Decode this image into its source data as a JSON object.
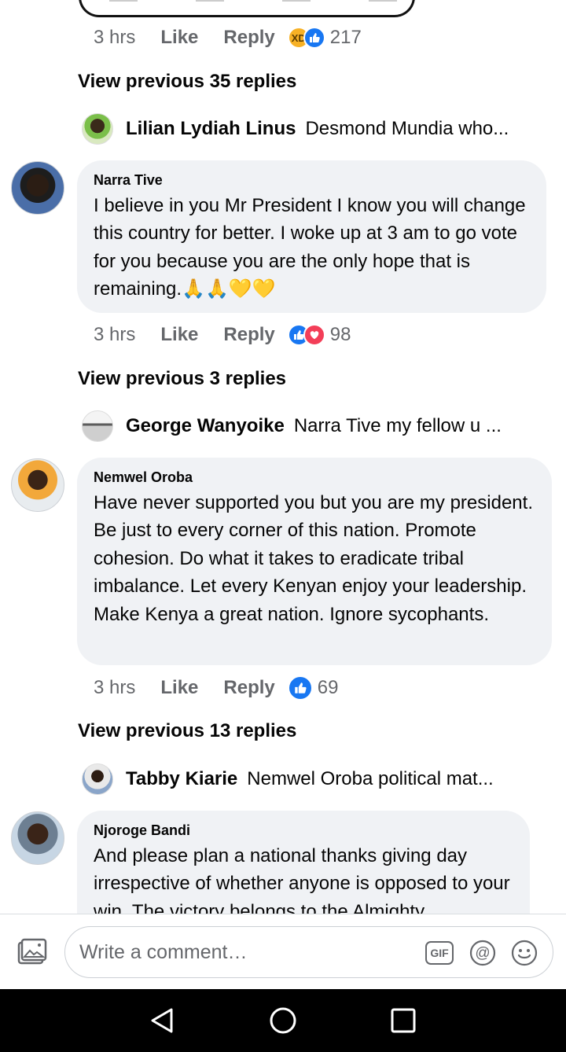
{
  "comments_top": {
    "meta": {
      "time": "3 hrs",
      "like": "Like",
      "reply": "Reply",
      "count": "217",
      "reactions": [
        "haha",
        "like"
      ]
    }
  },
  "threads": [
    {
      "view_previous": "View previous 35 replies",
      "reply_preview": {
        "name": "Lilian Lydiah Linus",
        "text": "Desmond Mundia who..."
      },
      "comment": {
        "author": "Narra Tive",
        "text": "I believe in you Mr President I know you will change this country for better. I woke up at 3 am to go vote for you because you are the only hope that is remaining.🙏🙏💛💛",
        "time": "3 hrs",
        "like": "Like",
        "reply": "Reply",
        "count": "98",
        "reactions": [
          "like",
          "love"
        ]
      }
    },
    {
      "view_previous": "View previous 3 replies",
      "reply_preview": {
        "name": "George Wanyoike",
        "text": "Narra Tive my fellow u ..."
      },
      "comment": {
        "author": "Nemwel Oroba",
        "text": "Have never supported you but you are my president. Be just to every corner of this nation. Promote cohesion. Do what it takes to eradicate tribal imbalance. Let every Kenyan enjoy your leadership. Make Kenya a great nation. Ignore sycophants.",
        "time": "3 hrs",
        "like": "Like",
        "reply": "Reply",
        "count": "69",
        "reactions": [
          "like"
        ]
      }
    },
    {
      "view_previous": "View previous 13 replies",
      "reply_preview": {
        "name": "Tabby Kiarie",
        "text": "Nemwel Oroba political mat..."
      },
      "comment": {
        "author": "Njoroge Bandi",
        "text": "And please plan a national thanks giving day irrespective of whether anyone is opposed to your win. The victory belongs to the Almighty"
      }
    }
  ],
  "composer": {
    "placeholder": "Write a comment…",
    "gif_label": "GIF",
    "icons": [
      "photo-icon",
      "gif-icon",
      "mention-icon",
      "emoji-icon"
    ]
  },
  "colors": {
    "like": "#1877f2",
    "love": "#f33e58",
    "haha": "#f7b125",
    "secondary_text": "#65676b",
    "bubble": "#f0f2f5"
  }
}
